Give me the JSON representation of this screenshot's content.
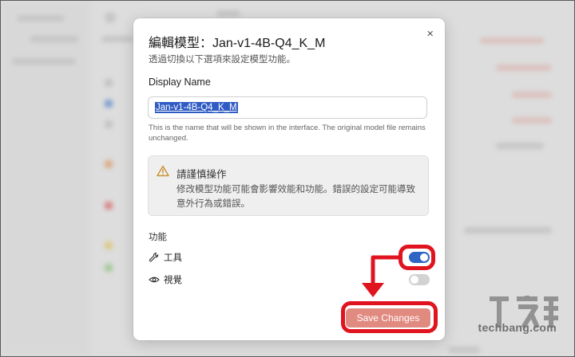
{
  "dialog": {
    "title": "編輯模型：Jan-v1-4B-Q4_K_M",
    "subtitle": "透過切換以下選項來設定模型功能。",
    "close_glyph": "×",
    "display_name": {
      "label": "Display Name",
      "value": "Jan-v1-4B-Q4_K_M",
      "help": "This is the name that will be shown in the interface. The original model file remains unchanged."
    },
    "warning": {
      "icon": "warning-triangle-icon",
      "title": "請謹慎操作",
      "body": "修改模型功能可能會影響效能和功能。錯誤的設定可能導致意外行為或錯誤。"
    },
    "capabilities": {
      "heading": "功能",
      "items": [
        {
          "icon": "wrench-icon",
          "label": "工具",
          "enabled": true
        },
        {
          "icon": "eye-icon",
          "label": "視覺",
          "enabled": false
        }
      ]
    },
    "save_label": "Save Changes"
  },
  "watermark": {
    "logo_text": "T客邦",
    "url": "techbang.com"
  },
  "colors": {
    "toggle_on": "#2f63c4",
    "save_button": "#e08a80",
    "annotation_red": "#e0141f",
    "selection": "#2f5bc4"
  }
}
